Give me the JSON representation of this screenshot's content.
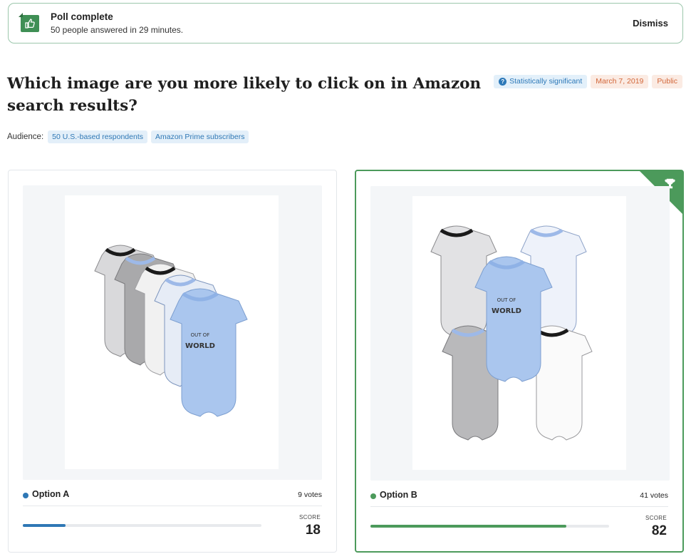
{
  "banner": {
    "title": "Poll complete",
    "subtitle": "50 people answered in 29 minutes.",
    "dismiss_label": "Dismiss",
    "icon": "thumbs-up-icon"
  },
  "poll": {
    "title": "Which image are you more likely to click on in Amazon search results?",
    "badges": {
      "significance": "Statistically significant",
      "date": "March 7, 2019",
      "visibility": "Public"
    },
    "audience": {
      "label": "Audience:",
      "tags": [
        "50 U.S.-based respondents",
        "Amazon Prime subscribers"
      ]
    }
  },
  "options": [
    {
      "label": "Option A",
      "votes": "9 votes",
      "score_label": "SCORE",
      "score": "18",
      "score_fraction": 0.18,
      "dot_color": "#2f78b5",
      "bar_color": "#2f78b5",
      "winner": false,
      "print_text": [
        "OUT OF",
        "WORLD"
      ]
    },
    {
      "label": "Option B",
      "votes": "41 votes",
      "score_label": "SCORE",
      "score": "82",
      "score_fraction": 0.82,
      "dot_color": "#4c9a5b",
      "bar_color": "#4c9a5b",
      "winner": true,
      "print_text": [
        "OUT OF",
        "WORLD"
      ]
    }
  ],
  "colors": {
    "winner_green": "#4c9a5b",
    "accent_blue": "#2f78b5"
  }
}
